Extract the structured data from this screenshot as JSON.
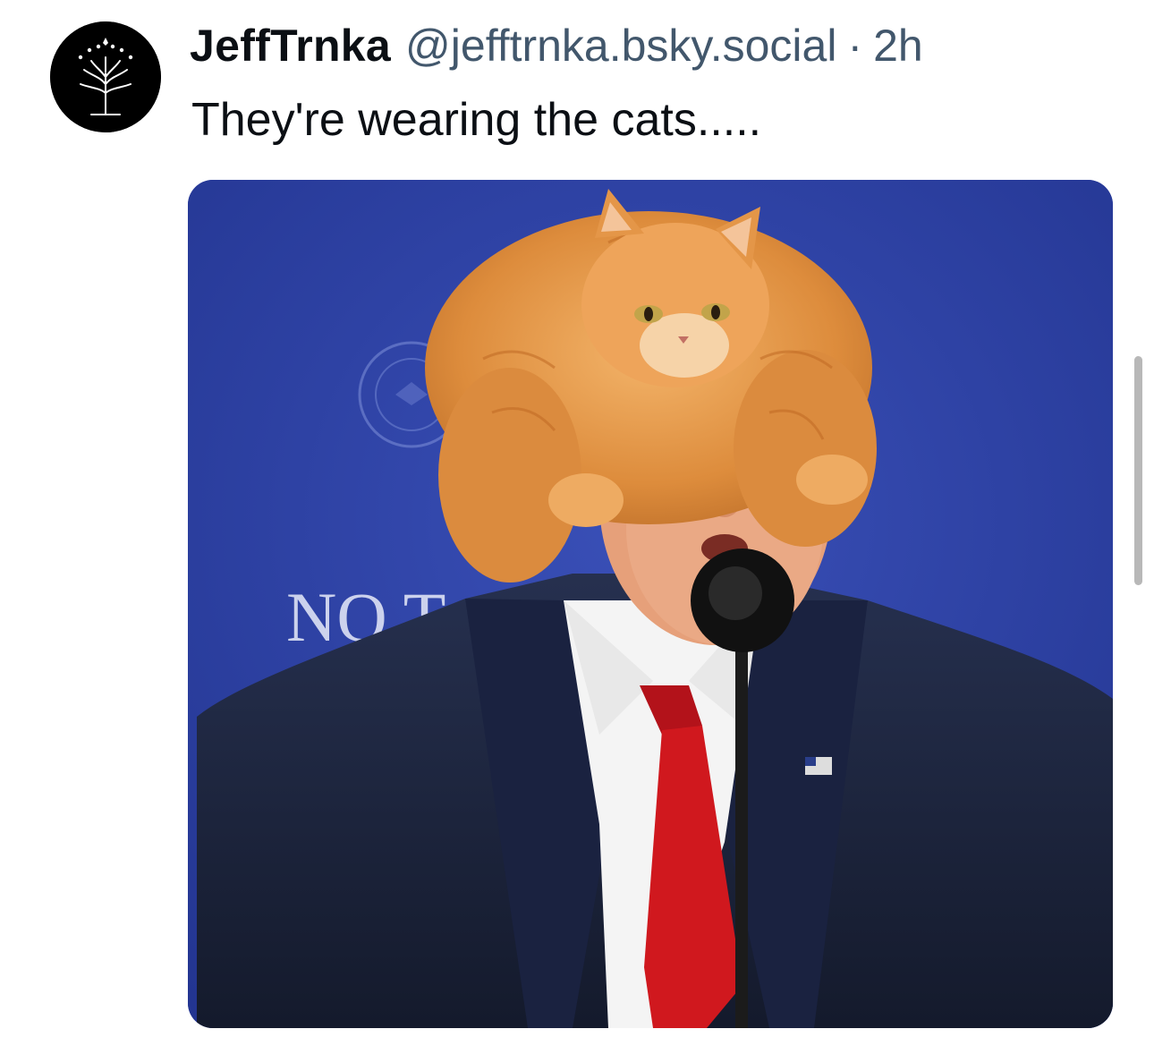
{
  "post": {
    "author": {
      "display_name": "JeffTrnka",
      "handle": "@jefftrnka.bsky.social",
      "avatar_icon": "white-tree-icon"
    },
    "separator": "·",
    "timestamp": "2h",
    "text": "They're wearing the cats.....",
    "image": {
      "sign_text": "NO T",
      "description_icon": "photo-cat-on-head"
    }
  },
  "colors": {
    "name": "#0b0f14",
    "meta": "#42576c",
    "backdrop": "#2f42a8",
    "cat": "#e59a4a",
    "tie": "#d0181e",
    "suit": "#1c2540"
  }
}
